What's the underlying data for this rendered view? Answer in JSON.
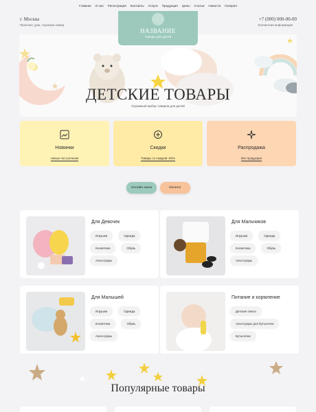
{
  "nav": [
    "Главная",
    "О нас",
    "Регистрация",
    "Контакты",
    "Услуги",
    "Продукция",
    "Цены",
    "Статьи",
    "Новости",
    "Галерея"
  ],
  "header": {
    "city": "г. Москва",
    "address": "Проспект, дом, строение номер",
    "phone": "+7 (000) 000-00-00",
    "contact": "Контактная информация",
    "logo_title": "НАЗВАНИЕ",
    "logo_subtitle": "Товары для детей"
  },
  "hero": {
    "title": "ДЕТСКИЕ ТОВАРЫ",
    "subtitle": "Огромный выбор товаров для детей"
  },
  "features": [
    {
      "title": "Новинки",
      "link": "Новые поступления",
      "color": "#fff2b5"
    },
    {
      "title": "Скидки",
      "link": "Товары со скидкой -50%",
      "color": "#ffeaa6"
    },
    {
      "title": "Распродажа",
      "link": "Вся продукция",
      "color": "#fdd6b3"
    }
  ],
  "buttons": {
    "online": "Онлайн заказ",
    "catalog": "Каталог",
    "online_color": "#9ccabd",
    "catalog_color": "#f8c39a"
  },
  "categories": [
    {
      "title": "Для Девочек",
      "tags": [
        "Игрушки",
        "Одежда",
        "Косметика",
        "Обувь",
        "Аксессуары"
      ]
    },
    {
      "title": "Для Мальчиков",
      "tags": [
        "Игрушки",
        "Одежда",
        "Косметика",
        "Обувь",
        "Аксессуары"
      ]
    },
    {
      "title": "Для Малышей",
      "tags": [
        "Игрушки",
        "Одежда",
        "Косметика",
        "Обувь",
        "Аксессуары"
      ]
    },
    {
      "title": "Питание и кормление",
      "tags": [
        "Детские смеси",
        "Аксессуары для бутылочек",
        "Бутылочки"
      ]
    }
  ],
  "popular": {
    "title": "Популярные товары"
  }
}
